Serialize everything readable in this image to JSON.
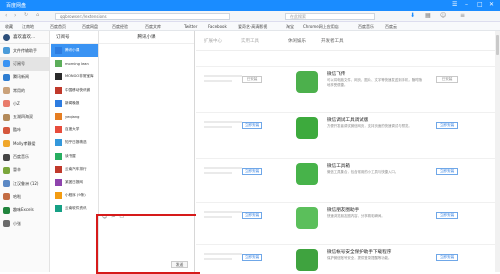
{
  "browser": {
    "title": "百度网盘",
    "address": "qqbrowser://extensions",
    "search_placeholder": "在此搜索",
    "bookmarks": [
      "收藏",
      "江南地",
      "百度首页",
      "百度网盘",
      "百度经验",
      "百度文库",
      "Twitter",
      "Facebook",
      "爱奇艺·高清影视",
      "淘宝",
      "Chrome网上应用店",
      "百度音乐",
      "百度云"
    ]
  },
  "sidebar": {
    "header": "喜欢喜欢...",
    "items": [
      {
        "label": "文件传输助手",
        "color": "#4a9bd9"
      },
      {
        "label": "订阅号",
        "color": "#3a93f3"
      },
      {
        "label": "腾讯新闻",
        "color": "#2e7dd1"
      },
      {
        "label": "常用的",
        "color": "#caa27a"
      },
      {
        "label": "小Z",
        "color": "#e97b6b"
      },
      {
        "label": "五湖四海双",
        "color": "#b38a5a"
      },
      {
        "label": "酷咔",
        "color": "#d5573c"
      },
      {
        "label": "Molly孝静爱",
        "color": "#f0a72a"
      },
      {
        "label": "百度音乐",
        "color": "#444"
      },
      {
        "label": "冒辛",
        "color": "#7aa63a"
      },
      {
        "label": "江汉鲁洲 (12)",
        "color": "#5b88c4"
      },
      {
        "label": "哈啦",
        "color": "#c36c43"
      },
      {
        "label": "趣味Excels",
        "color": "#20843c"
      },
      {
        "label": "小张",
        "color": "#6b6b6b"
      }
    ]
  },
  "subscriptions": {
    "header": "订阅号",
    "items": [
      {
        "label": "腾讯小课",
        "color": "#2d7ce0"
      },
      {
        "label": "morning lean",
        "color": "#5cae5a"
      },
      {
        "label": "MONGO非常宝库",
        "color": "#2b2b2b"
      },
      {
        "label": "中国移动快讯微",
        "color": "#c0392b"
      },
      {
        "label": "新闻晚报",
        "color": "#2d7ce0"
      },
      {
        "label": "yeqiang",
        "color": "#e67e22"
      },
      {
        "label": "百度大学",
        "color": "#e74c3c"
      },
      {
        "label": "知乎日报精选",
        "color": "#3498db"
      },
      {
        "label": "读书屋",
        "color": "#27ae60"
      },
      {
        "label": "云南汽车排行",
        "color": "#c0392b"
      },
      {
        "label": "某团日报网",
        "color": "#8e44ad"
      },
      {
        "label": "小程序 (9条)",
        "color": "#f39c12"
      },
      {
        "label": "云南软件资讯",
        "color": "#16a085"
      }
    ]
  },
  "chat": {
    "title": "腾讯小课",
    "send_label": "发送"
  },
  "main": {
    "tabs": [
      "扩展中心",
      "实用工具",
      "休闲娱乐",
      "开发者工具"
    ],
    "installed_label": "已安装",
    "install_label": "立即安装",
    "extensions": [
      {
        "name": "微信飞传",
        "desc": "可以将电脑文件、网页、图片、文字等快速发送到手机，随时随地享受便捷。",
        "color": "#4cb04c",
        "status": "installed"
      },
      {
        "name": "微信调试工具调试版",
        "desc": "方便开发者调试微信网页，支持页面的快速调试与预览。",
        "color": "#3daa3d",
        "status": "install"
      },
      {
        "name": "微信工具箱",
        "desc": "微信工具集合，包含常用的小工具与快捷入口。",
        "color": "#47b34a",
        "status": "install"
      },
      {
        "name": "微信朋友圈助手",
        "desc": "快速浏览朋友圈内容，分享精彩瞬间。",
        "color": "#5bbf5b",
        "status": "install"
      },
      {
        "name": "微信帐号安全保护助手下载程序",
        "desc": "保护微信账号安全，提供登录提醒等功能。",
        "color": "#3fa33f",
        "status": "install"
      }
    ],
    "left_column_buttons": [
      "已安装",
      "立即安装",
      "立即安装",
      "立即安装",
      "立即安装"
    ]
  }
}
